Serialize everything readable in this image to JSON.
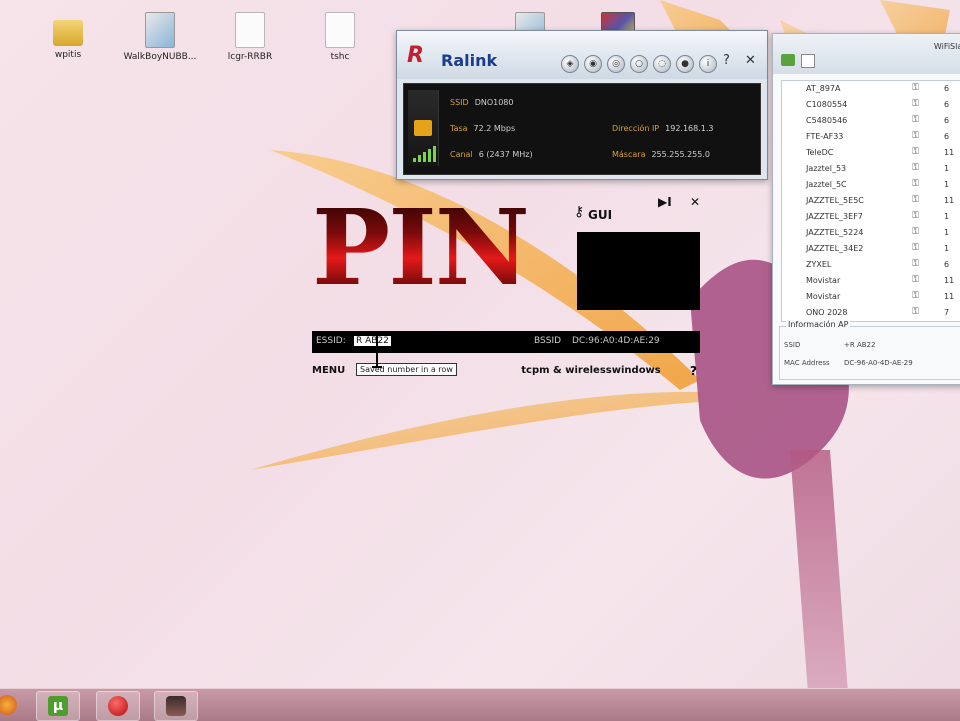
{
  "desktop": {
    "icons": [
      {
        "label": "wpitis",
        "type": "folder"
      },
      {
        "label": "WalkBoyNUBB...",
        "type": "img"
      },
      {
        "label": "lcgr-RRBR",
        "type": "file"
      },
      {
        "label": "tshc",
        "type": "file"
      }
    ]
  },
  "ralink": {
    "brand": "Ralink",
    "ssid_label": "SSID",
    "ssid_value": "DNO1080",
    "speed_label": "Tasa",
    "speed_value": "72.2 Mbps",
    "channel_label": "Canal",
    "channel_value": "6 (2437 MHz)",
    "ip_label": "Dirección IP",
    "ip_value": "192.168.1.3",
    "mask_label": "Máscara",
    "mask_value": "255.255.255.0",
    "close_glyph": "✕",
    "help_glyph": "?"
  },
  "wifi_list": {
    "title": "WiFiSlax",
    "networks": [
      {
        "ssid": "AT_897A",
        "channel": "6"
      },
      {
        "ssid": "C1080554",
        "channel": "6"
      },
      {
        "ssid": "C5480546",
        "channel": "6"
      },
      {
        "ssid": "FTE-AF33",
        "channel": "6"
      },
      {
        "ssid": "TeleDC",
        "channel": "11"
      },
      {
        "ssid": "Jazztel_53",
        "channel": "1"
      },
      {
        "ssid": "Jazztel_5C",
        "channel": "1"
      },
      {
        "ssid": "JAZZTEL_5E5C",
        "channel": "11"
      },
      {
        "ssid": "JAZZTEL_3EF7",
        "channel": "1"
      },
      {
        "ssid": "JAZZTEL_5224",
        "channel": "1"
      },
      {
        "ssid": "JAZZTEL_34E2",
        "channel": "1"
      },
      {
        "ssid": "ZYXEL",
        "channel": "6"
      },
      {
        "ssid": "Movistar",
        "channel": "11"
      },
      {
        "ssid": "Movistar",
        "channel": "11"
      },
      {
        "ssid": "ONO 2028",
        "channel": "7"
      }
    ],
    "info_legend": "Información AP",
    "info_ssid_label": "SSID",
    "info_ssid_value": "+R AB22",
    "info_mac_label": "MAC Address",
    "info_mac_value": "DC-96-A0-4D-AE-29"
  },
  "pin": {
    "title": "PIN",
    "gui_label": "GUI",
    "play_glyph": "▶I",
    "close_glyph": "✕",
    "essid_label": "ESSID:",
    "essid_value": "R AB22",
    "bssid_label": "BSSID",
    "bssid_value": "DC:96:A0:4D:AE:29",
    "menu_label": "MENU",
    "tooltip": "Saved number in a row",
    "menu_text": "tcpm & wirelesswindows",
    "help": "?"
  },
  "taskbar": {
    "items": [
      "firefox",
      "utorrent",
      "record",
      "user"
    ]
  },
  "colors": {
    "accent_red": "#c41f2f",
    "ralink_blue": "#1c3c8c",
    "info_orange": "#d8a234"
  }
}
